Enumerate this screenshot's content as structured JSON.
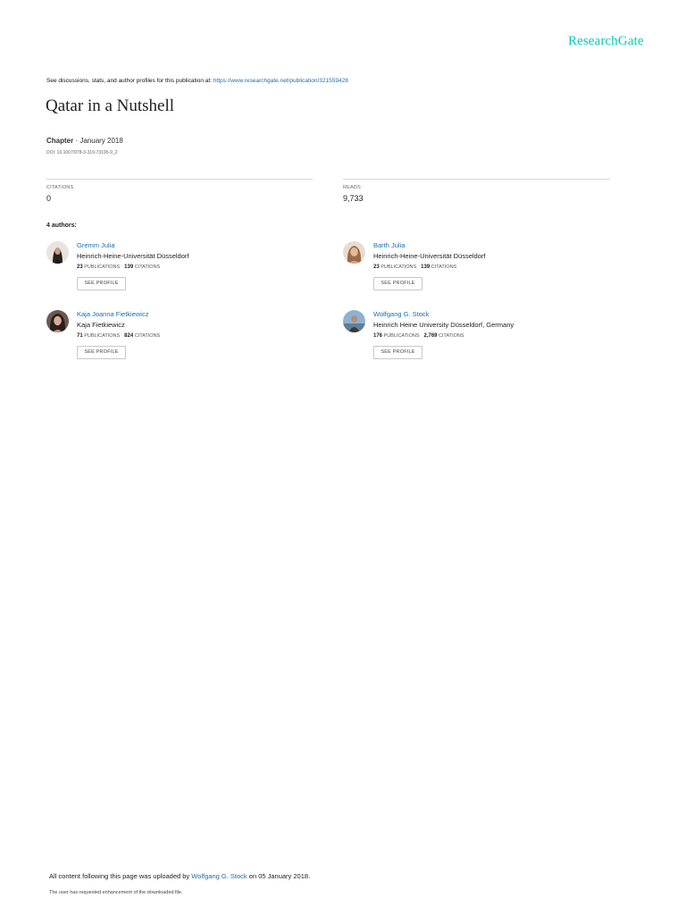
{
  "brand": {
    "logo_text": "ResearchGate",
    "accent_color": "#00ccbb",
    "link_color": "#1a6fb0"
  },
  "header": {
    "discussion_text": "See discussions, stats, and author profiles for this publication at: ",
    "publication_url": "https://www.researchgate.net/publication/321559428"
  },
  "publication": {
    "title": "Qatar in a Nutshell",
    "type": "Chapter",
    "separator": " · ",
    "date": "January 2018",
    "doi": "DOI: 10.1007/978-3-319-73195-9_2"
  },
  "stats": {
    "citations_label": "CITATIONS",
    "citations_value": "0",
    "reads_label": "READS",
    "reads_value": "9,733"
  },
  "authors_heading": "4 authors:",
  "authors": [
    {
      "name": "Gremm Julia",
      "institution": "Heinrich-Heine-Universität Düsseldorf",
      "publications_count": "23",
      "publications_label": "PUBLICATIONS",
      "citations_count": "139",
      "citations_label": "CITATIONS",
      "button_label": "SEE PROFILE"
    },
    {
      "name": "Barth Julia",
      "institution": "Heinrich-Heine-Universität Düsseldorf",
      "publications_count": "23",
      "publications_label": "PUBLICATIONS",
      "citations_count": "139",
      "citations_label": "CITATIONS",
      "button_label": "SEE PROFILE"
    },
    {
      "name": "Kaja Joanna Fietkiewicz",
      "institution": "Kaja Fietkiewicz",
      "publications_count": "71",
      "publications_label": "PUBLICATIONS",
      "citations_count": "824",
      "citations_label": "CITATIONS",
      "button_label": "SEE PROFILE"
    },
    {
      "name": "Wolfgang G. Stock",
      "institution": "Heinrich Heine University Düsseldorf, Germany",
      "publications_count": "176",
      "publications_label": "PUBLICATIONS",
      "citations_count": "2,769",
      "citations_label": "CITATIONS",
      "button_label": "SEE PROFILE"
    }
  ],
  "footer": {
    "uploaded_prefix": "All content following this page was uploaded by ",
    "uploader": "Wolfgang G. Stock",
    "uploaded_suffix": " on 05 January 2018.",
    "enhancement_note": "The user has requested enhancement of the downloaded file."
  }
}
